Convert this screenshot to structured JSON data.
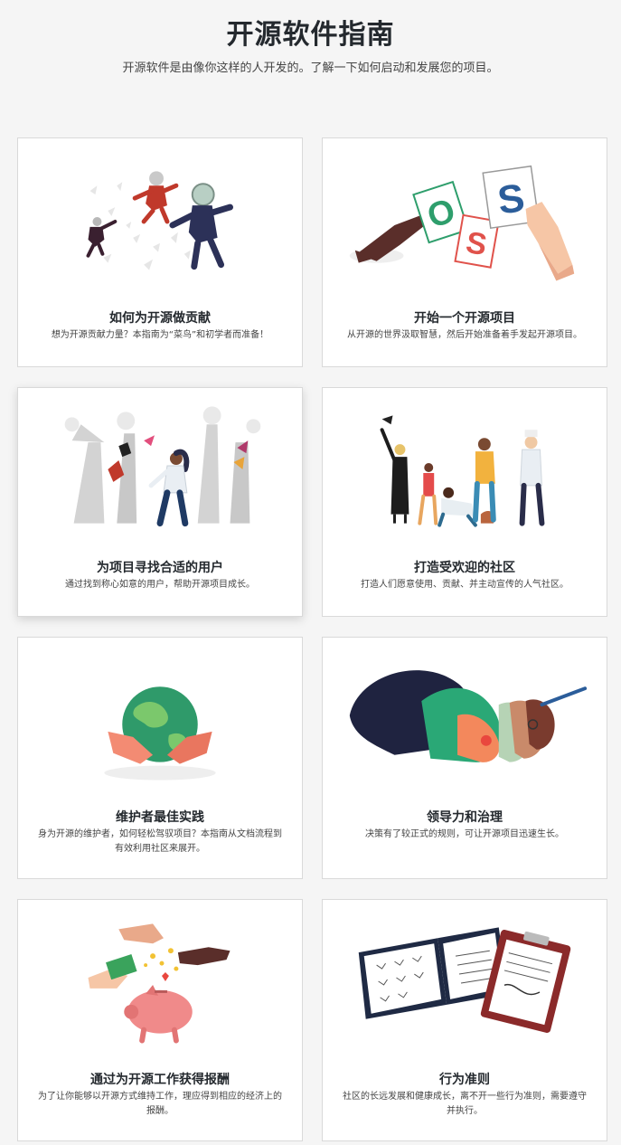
{
  "header": {
    "title": "开源软件指南",
    "subtitle": "开源软件是由像你这样的人开发的。了解一下如何启动和发展您的项目。"
  },
  "cards": [
    {
      "title": "如何为开源做贡献",
      "desc": "想为开源贡献力量？本指南为“菜鸟”和初学者而准备！",
      "icon": "astronauts-icon"
    },
    {
      "title": "开始一个开源项目",
      "desc": "从开源的世界汲取智慧，然后开始准备着手发起开源项目。",
      "icon": "oss-cards-icon",
      "letters": [
        "O",
        "S",
        "S"
      ]
    },
    {
      "title": "为项目寻找合适的用户",
      "desc": "通过找到称心如意的用户，帮助开源项目成长。",
      "icon": "forest-explorer-icon"
    },
    {
      "title": "打造受欢迎的社区",
      "desc": "打造人们愿意使用、贡献、并主动宣传的人气社区。",
      "icon": "community-people-icon"
    },
    {
      "title": "维护者最佳实践",
      "desc": "身为开源的维护者，如何轻松驾驭项目？本指南从文档流程到有效利用社区来展开。",
      "icon": "globe-hands-icon"
    },
    {
      "title": "领导力和治理",
      "desc": "决策有了较正式的规则，可让开源项目迅速生长。",
      "icon": "faces-profile-icon"
    },
    {
      "title": "通过为开源工作获得报酬",
      "desc": "为了让你能够以开源方式维持工作，理应得到相应的经济上的报酬。",
      "icon": "piggy-bank-icon"
    },
    {
      "title": "行为准则",
      "desc": "社区的长远发展和健康成长，离不开一些行为准则，需要遵守并执行。",
      "icon": "playbook-clipboard-icon"
    }
  ],
  "colors": {
    "page_bg": "#f5f5f5",
    "card_bg": "#ffffff",
    "card_border": "#d9d9d9",
    "oss_green": "#2e9e6c",
    "oss_red": "#e0524b",
    "oss_blue": "#2b5d9a"
  }
}
